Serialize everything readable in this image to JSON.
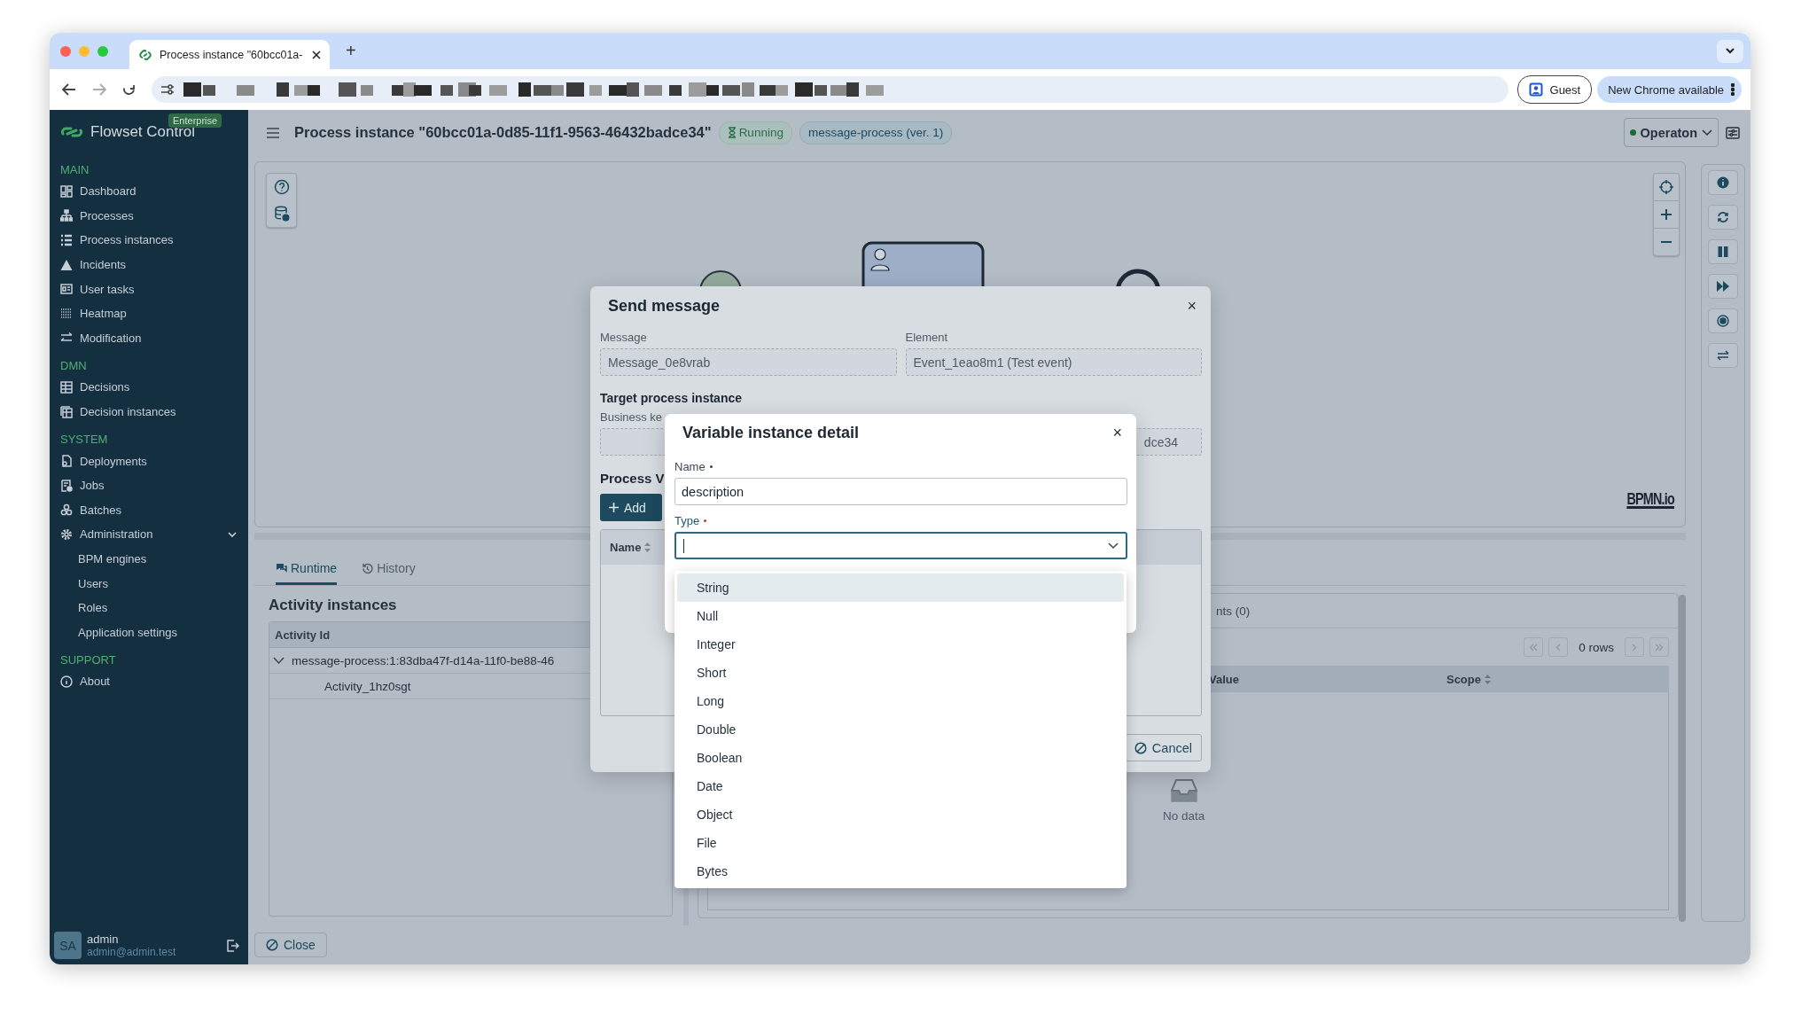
{
  "browser": {
    "tabs": [
      {
        "title": "Process instance \"60bcc01a-",
        "selected": true
      }
    ],
    "new_tab": "+",
    "guest": "Guest",
    "update": "New Chrome available"
  },
  "sidebar": {
    "brand": "Flowset Control",
    "badge": "Enterprise",
    "sections": [
      {
        "title": "MAIN",
        "items": [
          {
            "label": "Dashboard"
          },
          {
            "label": "Processes"
          },
          {
            "label": "Process instances"
          },
          {
            "label": "Incidents"
          },
          {
            "label": "User tasks"
          },
          {
            "label": "Heatmap"
          },
          {
            "label": "Modification"
          }
        ]
      },
      {
        "title": "DMN",
        "items": [
          {
            "label": "Decisions"
          },
          {
            "label": "Decision instances"
          }
        ]
      },
      {
        "title": "SYSTEM",
        "items": [
          {
            "label": "Deployments"
          },
          {
            "label": "Jobs"
          },
          {
            "label": "Batches"
          },
          {
            "label": "Administration",
            "expanded": true,
            "children": [
              {
                "label": "BPM engines"
              },
              {
                "label": "Users"
              },
              {
                "label": "Roles"
              },
              {
                "label": "Application settings"
              }
            ]
          }
        ]
      },
      {
        "title": "SUPPORT",
        "items": [
          {
            "label": "About"
          }
        ]
      }
    ],
    "user": {
      "initials": "SA",
      "name": "admin",
      "email": "admin@admin.test"
    }
  },
  "header": {
    "title": "Process instance \"60bcc01a-0d85-11f1-9563-46432badce34\"",
    "status": "Running",
    "process": "message-process (ver. 1)",
    "engine": {
      "name": "Operaton",
      "connected": true
    }
  },
  "diagram": {
    "attribution": "BPMN.io"
  },
  "bottom": {
    "tabs": [
      {
        "label": "Runtime",
        "selected": true
      },
      {
        "label": "History",
        "selected": false
      }
    ],
    "activity": {
      "title": "Activity instances",
      "column": "Activity Id",
      "rows": [
        {
          "label": "message-process:1:83dba47f-d14a-11f0-be88-46",
          "expanded": true,
          "children": [
            {
              "label": "Activity_1hz0sgt"
            }
          ]
        }
      ]
    },
    "variables": {
      "tab": "nts (0)",
      "rows_label": "0 rows",
      "columns": [
        {
          "label": "Value",
          "sortable": false
        },
        {
          "label": "Scope",
          "sortable": true
        }
      ],
      "empty": "No data"
    },
    "close": "Close"
  },
  "send_dialog": {
    "title": "Send message",
    "close": "×",
    "fields": [
      {
        "label": "Message",
        "value": "Message_0e8vrab"
      },
      {
        "label": "Element",
        "value": "Event_1eao8m1 (Test event)"
      }
    ],
    "target": {
      "heading": "Target process instance",
      "label": "Business ke",
      "value": "dce34"
    },
    "variables": {
      "heading": "Process V",
      "add": "Add",
      "column": "Name"
    },
    "cancel": "Cancel"
  },
  "variable_dialog": {
    "title": "Variable instance detail",
    "close": "×",
    "name": {
      "label": "Name",
      "required": true,
      "value": "description"
    },
    "type": {
      "label": "Type",
      "required": true,
      "focused": true
    },
    "options": [
      {
        "label": "String",
        "selected": true
      },
      {
        "label": "Null",
        "selected": false
      },
      {
        "label": "Integer",
        "selected": false
      },
      {
        "label": "Short",
        "selected": false
      },
      {
        "label": "Long",
        "selected": false
      },
      {
        "label": "Double",
        "selected": false
      },
      {
        "label": "Boolean",
        "selected": false
      },
      {
        "label": "Date",
        "selected": false
      },
      {
        "label": "Object",
        "selected": false
      },
      {
        "label": "File",
        "selected": false
      },
      {
        "label": "Bytes",
        "selected": false
      }
    ]
  }
}
